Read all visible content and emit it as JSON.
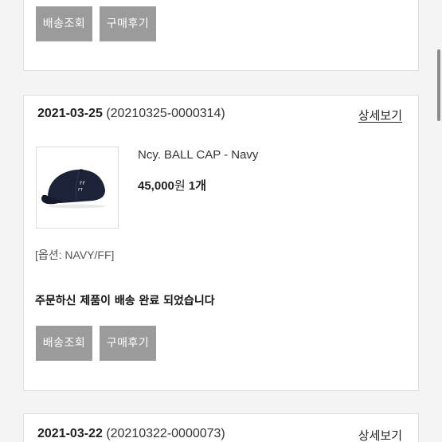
{
  "orders": [
    {
      "buttons": {
        "shipping_label": "배송조회",
        "review_label": "구매후기"
      }
    },
    {
      "date": "2021-03-25",
      "order_number": "(20210325-0000314)",
      "detail_label": "상세보기",
      "product": {
        "name": "Ncy. BALL CAP - Navy",
        "price": "45,000",
        "currency": "원",
        "quantity": "1개",
        "option": "[옵션: NAVY/FF]",
        "image_icon": "navy-ball-cap-image"
      },
      "status": "주문하신 제품이 배송 완료 되었습니다",
      "buttons": {
        "shipping_label": "배송조회",
        "review_label": "구매후기"
      }
    },
    {
      "date": "2021-03-22",
      "order_number": "(20210322-0000073)",
      "detail_label": "상세보기"
    }
  ],
  "colors": {
    "background": "#f4f4f4",
    "card": "#ffffff",
    "button": "#9b9b9b",
    "cap": "#1c2238"
  }
}
